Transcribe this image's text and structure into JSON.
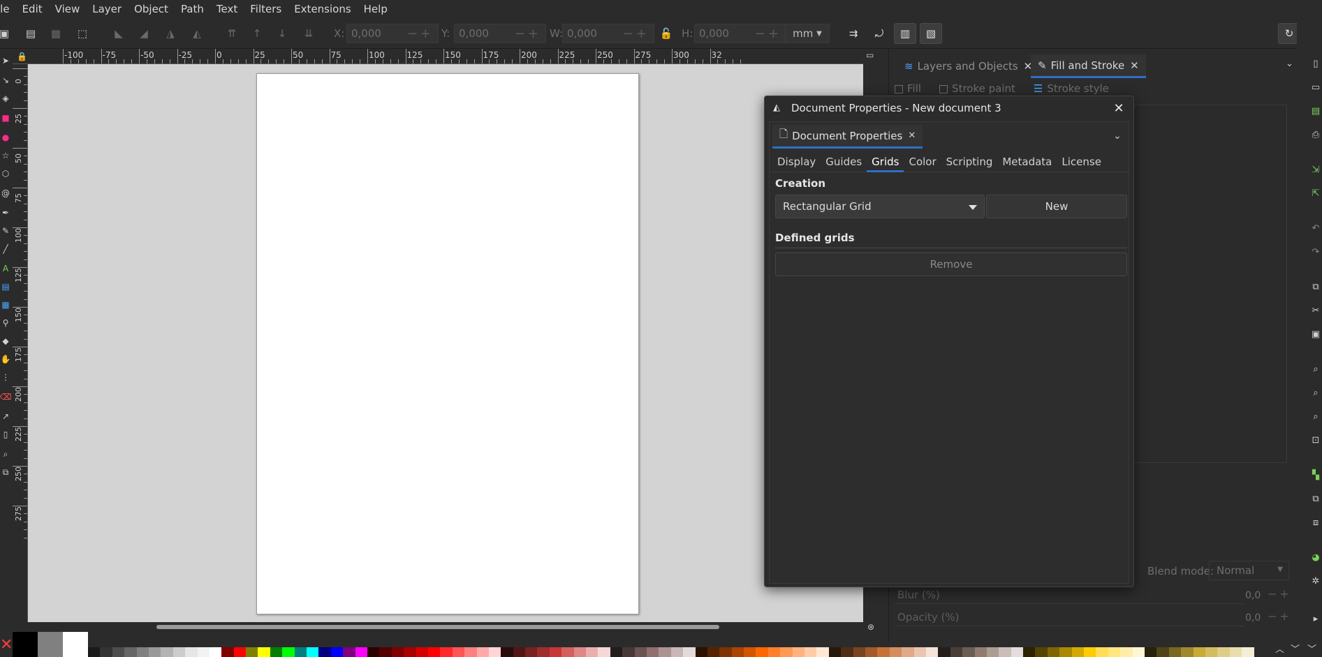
{
  "menu": [
    "ile",
    "Edit",
    "View",
    "Layer",
    "Object",
    "Path",
    "Text",
    "Filters",
    "Extensions",
    "Help"
  ],
  "toolbar": {
    "x_label": "X:",
    "x_value": "0,000",
    "y_label": "Y:",
    "y_value": "0,000",
    "w_label": "W:",
    "w_value": "0,000",
    "h_label": "H:",
    "h_value": "0,000",
    "unit": "mm"
  },
  "ruler": {
    "h_labels": [
      "-100",
      "-75",
      "-50",
      "-25",
      "0",
      "25",
      "50",
      "75",
      "100",
      "125",
      "150",
      "175",
      "200",
      "225",
      "250",
      "275",
      "300",
      "32"
    ],
    "v_labels": [
      "0",
      "25",
      "50",
      "75",
      "100",
      "125",
      "150",
      "175",
      "200",
      "225",
      "250",
      "275"
    ]
  },
  "dock": {
    "tabs": [
      {
        "label": "Layers and Objects",
        "active": false
      },
      {
        "label": "Fill and Stroke",
        "active": true
      }
    ],
    "fill_label": "Fill",
    "stroke_paint_label": "Stroke paint",
    "stroke_style_label": "Stroke style",
    "blend_mode_label": "Blend mode:",
    "blend_mode_value": "Normal",
    "blur_label": "Blur (%)",
    "blur_value": "0,0",
    "opacity_label": "Opacity (%)",
    "opacity_value": "0,0"
  },
  "dialog": {
    "title": "Document Properties - New document 3",
    "doc_tab": "Document Properties",
    "tabs": [
      {
        "label": "Display",
        "active": false
      },
      {
        "label": "Guides",
        "active": false
      },
      {
        "label": "Grids",
        "active": true
      },
      {
        "label": "Color",
        "active": false
      },
      {
        "label": "Scripting",
        "active": false
      },
      {
        "label": "Metadata",
        "active": false
      },
      {
        "label": "License",
        "active": false
      }
    ],
    "creation_heading": "Creation",
    "grid_type": "Rectangular Grid",
    "new_button": "New",
    "defined_heading": "Defined grids",
    "remove_button": "Remove"
  },
  "colors": {
    "accent": "#2f6fc4",
    "canvas": "#d3d3d3",
    "page": "#ffffff",
    "ui_bg": "#2b2b2b"
  },
  "palette": [
    "#1a1a1a",
    "#333333",
    "#4d4d4d",
    "#666666",
    "#808080",
    "#999999",
    "#b3b3b3",
    "#cccccc",
    "#e6e6e6",
    "#f2f2f2",
    "#ffffff",
    "#800000",
    "#ff0000",
    "#808000",
    "#ffff00",
    "#008000",
    "#00ff00",
    "#008080",
    "#00ffff",
    "#000080",
    "#0000ff",
    "#800080",
    "#ff00ff",
    "#2b0000",
    "#550000",
    "#800000",
    "#aa0000",
    "#d40000",
    "#ff0000",
    "#ff2a2a",
    "#ff5555",
    "#ff8080",
    "#ffaaaa",
    "#ffd5d5",
    "#280b0b",
    "#501616",
    "#782121",
    "#a02c2c",
    "#c83737",
    "#d35f5f",
    "#de8787",
    "#e9afaf",
    "#f4d7d7",
    "#241c1c",
    "#483737",
    "#6c5353",
    "#916f6f",
    "#ac9393",
    "#c8b7b7",
    "#e3dbdb",
    "#2b1100",
    "#552200",
    "#803300",
    "#aa4400",
    "#d45500",
    "#ff6600",
    "#ff7f2a",
    "#ff9955",
    "#ffb380",
    "#ffccaa",
    "#ffe6d5",
    "#28170b",
    "#502d16",
    "#784421",
    "#a05a2c",
    "#c87137",
    "#d38d5f",
    "#deaa87",
    "#e9c6af",
    "#f4e3d7",
    "#241f1c",
    "#483e37",
    "#6c5d53",
    "#917c6f",
    "#ac9d93",
    "#c8beb7",
    "#e3dedb",
    "#2b2200",
    "#554400",
    "#806600",
    "#aa8800",
    "#d4aa00",
    "#ffcc00",
    "#ffdd55",
    "#ffe680",
    "#ffeeaa",
    "#fff6d5",
    "#28220b",
    "#504416",
    "#786721",
    "#a0892c",
    "#c8ab37",
    "#d3bc5f",
    "#decd87",
    "#e9ddaf",
    "#f4eed7"
  ]
}
